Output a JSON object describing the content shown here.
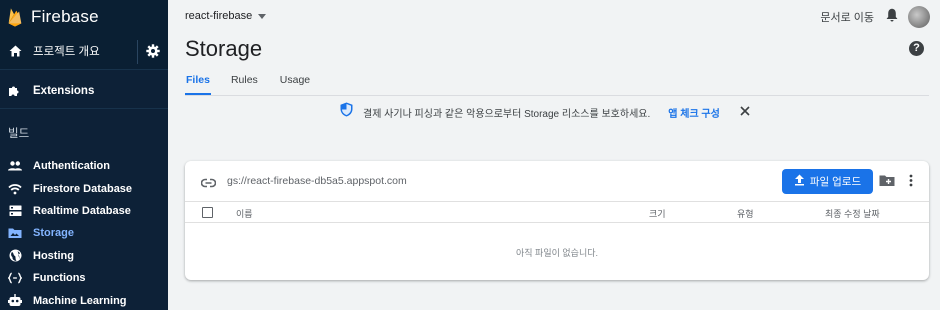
{
  "sidebar": {
    "brand": "Firebase",
    "overview_label": "프로젝트 개요",
    "extensions_label": "Extensions",
    "category": "빌드",
    "items": [
      {
        "label": "Authentication",
        "icon": "people-icon"
      },
      {
        "label": "Firestore Database",
        "icon": "wifi-icon"
      },
      {
        "label": "Realtime Database",
        "icon": "database-icon"
      },
      {
        "label": "Storage",
        "icon": "folder-icon",
        "active": true
      },
      {
        "label": "Hosting",
        "icon": "globe-icon"
      },
      {
        "label": "Functions",
        "icon": "functions-icon"
      },
      {
        "label": "Machine Learning",
        "icon": "robot-icon"
      }
    ]
  },
  "header": {
    "project": "react-firebase",
    "docs_link": "문서로 이동",
    "title": "Storage"
  },
  "tabs": [
    {
      "label": "Files",
      "active": true
    },
    {
      "label": "Rules"
    },
    {
      "label": "Usage"
    }
  ],
  "banner": {
    "message": "결제 사기나 피싱과 같은 악용으로부터 Storage 리소스를 보호하세요.",
    "action": "앱 체크 구성"
  },
  "files": {
    "bucket_path": "gs://react-firebase-db5a5.appspot.com",
    "upload_label": "파일 업로드",
    "columns": {
      "name": "이름",
      "size": "크기",
      "type": "유형",
      "modified": "최종 수정 날짜"
    },
    "empty_message": "아직 파일이 없습니다."
  },
  "colors": {
    "sidebar_bg": "#0d2137",
    "accent": "#1a73e8",
    "active_nav": "#82b4ff",
    "firebase_flame": "#ffa000"
  }
}
